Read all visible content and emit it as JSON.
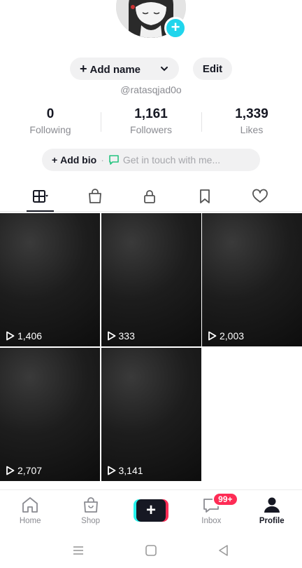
{
  "profile": {
    "add_name_label": "Add name",
    "edit_label": "Edit",
    "username": "@ratasqjad0o",
    "stats": [
      {
        "value": "0",
        "label": "Following"
      },
      {
        "value": "1,161",
        "label": "Followers"
      },
      {
        "value": "1,339",
        "label": "Likes"
      }
    ],
    "add_bio_label": "Add bio",
    "bio_hint": "Get in touch with me..."
  },
  "tabs": [
    "grid-icon",
    "shop-bag-icon",
    "lock-icon",
    "bookmark-icon",
    "heart-icon"
  ],
  "videos": [
    {
      "views": "1,406"
    },
    {
      "views": "333"
    },
    {
      "views": "2,003"
    },
    {
      "views": "2,707"
    },
    {
      "views": "3,141"
    }
  ],
  "nav": {
    "home": "Home",
    "shop": "Shop",
    "create": "+",
    "inbox": "Inbox",
    "inbox_badge": "99+",
    "profile": "Profile"
  },
  "colors": {
    "accent_cyan": "#20d5ec",
    "badge_red": "#fe2c55",
    "text_dark": "#161823",
    "text_muted": "#8a8b91"
  }
}
